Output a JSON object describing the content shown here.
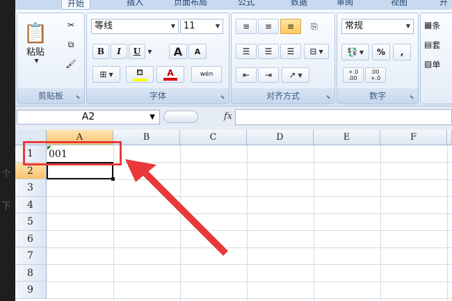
{
  "tabs": [
    "开始",
    "插入",
    "页面布局",
    "公式",
    "数据",
    "审阅",
    "视图",
    "开发"
  ],
  "ribbon": {
    "clipboard": {
      "paste_label": "粘贴",
      "group_label": "剪贴板"
    },
    "font": {
      "name": "等线",
      "size": "11",
      "group_label": "字体",
      "bold": "B",
      "italic": "I",
      "underline": "U",
      "grow": "A",
      "shrink": "A",
      "phonetic": "wén"
    },
    "alignment": {
      "group_label": "对齐方式"
    },
    "number": {
      "format": "常规",
      "group_label": "数字",
      "percent": "%",
      "comma": ",",
      "inc": "+.0\n.00",
      "dec": ".00\n+.0"
    },
    "styles": {
      "cond": "条",
      "table": "套",
      "cell": "单"
    }
  },
  "formula_bar": {
    "name_box": "A2",
    "fx": "fx",
    "content": ""
  },
  "columns": [
    "A",
    "B",
    "C",
    "D",
    "E",
    "F"
  ],
  "rows": [
    "1",
    "2",
    "3",
    "4",
    "5",
    "6",
    "7",
    "8",
    "9"
  ],
  "cells": {
    "A1": "001"
  },
  "ghost_text": [
    "个",
    "下"
  ],
  "colors": {
    "accent": "#f6c36d",
    "highlight": "#e8383a",
    "ribbon": "#dde8f6"
  }
}
